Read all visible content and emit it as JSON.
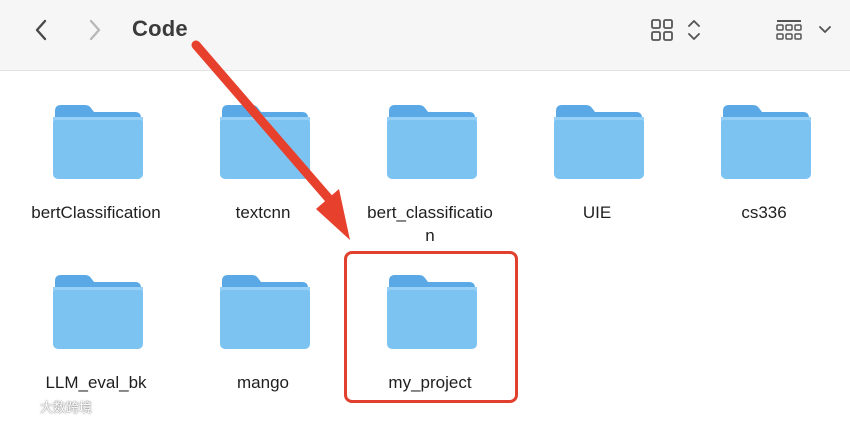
{
  "window": {
    "title": "Code"
  },
  "toolbar": {
    "back_icon": "chevron-left-icon",
    "forward_icon": "chevron-right-icon",
    "view_icon": "icon-grid-view-icon",
    "view_sort_icon": "chevron-up-down-icon",
    "group_icon": "group-grid-icon",
    "group_menu_icon": "chevron-down-icon"
  },
  "folders": [
    {
      "name": "bertClassification"
    },
    {
      "name": "textcnn"
    },
    {
      "name": "bert_classificatio\nn"
    },
    {
      "name": "UIE"
    },
    {
      "name": "cs336"
    },
    {
      "name": "LLM_eval_bk"
    },
    {
      "name": "mango"
    },
    {
      "name": "my_project"
    }
  ],
  "annotation": {
    "highlight_color": "#e2402f",
    "arrow_color": "#e7402c"
  },
  "watermark": {
    "text": "大数跨境"
  },
  "colors": {
    "folder_front": "#7cc3f2",
    "folder_back": "#5aa9e6",
    "toolbar_bg": "#f6f6f6"
  }
}
